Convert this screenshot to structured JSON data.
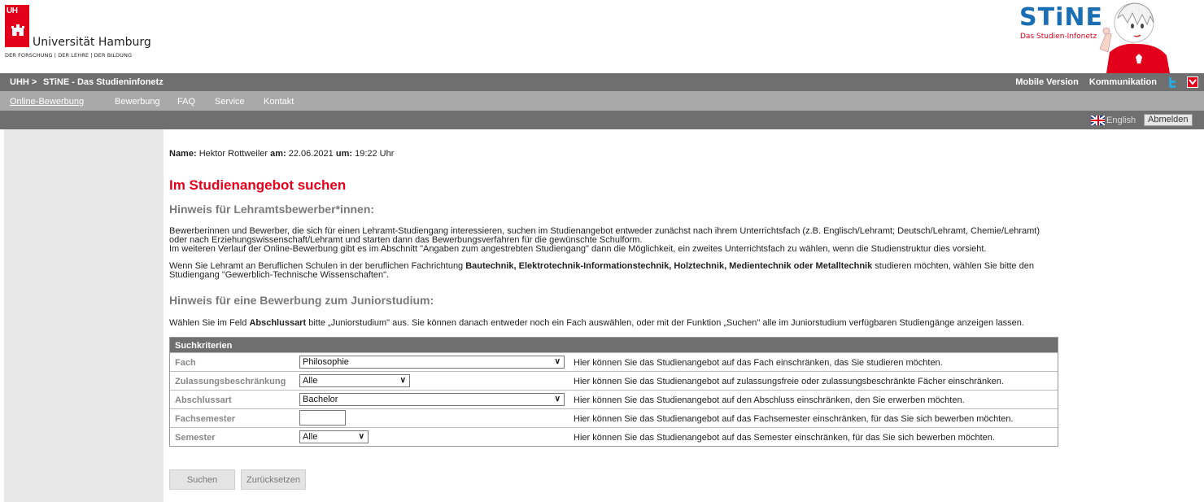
{
  "header": {
    "uh_logo": "UH",
    "university_name": "Universität Hamburg",
    "motto": "DER FORSCHUNG | DER LEHRE | DER BILDUNG",
    "stine_logo": "STiNE",
    "stine_subtitle": "Das Studien-Infonetz"
  },
  "topbar": {
    "crumb_uhh": "UHH >",
    "crumb_stine": "STiNE - Das Studieninfonetz",
    "mobile_version": "Mobile Version",
    "communication": "Kommunikation"
  },
  "nav": [
    {
      "label": "Online-Bewerbung",
      "active": true
    },
    {
      "label": "Bewerbung",
      "active": false
    },
    {
      "label": "FAQ",
      "active": false
    },
    {
      "label": "Service",
      "active": false
    },
    {
      "label": "Kontakt",
      "active": false
    }
  ],
  "langbar": {
    "english": "English",
    "logout": "Abmelden"
  },
  "user": {
    "name_label": "Name:",
    "name": "Hektor Rottweiler",
    "date_label": "am:",
    "date": "22.06.2021",
    "time_label": "um:",
    "time": "19:22 Uhr"
  },
  "content": {
    "title": "Im Studienangebot suchen",
    "hint1_title": "Hinweis für Lehramtsbewerber*innen:",
    "hint1_p1_line1": "Bewerberinnen und Bewerber, die sich für einen Lehramt-Studiengang interessieren, suchen im Studienangebot entweder zunächst nach ihrem Unterrichtsfach (z.B. Englisch/Lehramt; Deutsch/Lehramt, Chemie/Lehramt)",
    "hint1_p1_line2": "oder nach Erziehungswissenschaft/Lehramt und starten dann das Bewerbungsverfahren für die gewünschte Schulform.",
    "hint1_p1_line3": "Im weiteren Verlauf der Online-Bewerbung gibt es im Abschnitt \"Angaben zum angestrebten Studiengang\" dann die Möglichkeit, ein zweites Unterrichtsfach zu wählen, wenn die Studienstruktur dies vorsieht.",
    "hint1_p2_pre": "Wenn Sie Lehramt an Beruflichen Schulen in der beruflichen Fachrichtung ",
    "hint1_p2_bold": "Bautechnik, Elektrotechnik-Informationstechnik, Holztechnik, Medientechnik oder Metalltechnik",
    "hint1_p2_post": " studieren möchten, wählen Sie bitte den",
    "hint1_p2_line2": "Studiengang \"Gewerblich-Technische Wissenschaften\".",
    "hint2_title": "Hinweis für eine Bewerbung zum Juniorstudium:",
    "hint2_pre": "Wählen Sie im Feld ",
    "hint2_bold": "Abschlussart",
    "hint2_post": " bitte „Juniorstudium\" aus. Sie können danach entweder noch ein Fach auswählen, oder mit der Funktion „Suchen\" alle im Juniorstudium verfügbaren Studiengänge anzeigen lassen."
  },
  "criteria": {
    "header": "Suchkriterien",
    "rows": [
      {
        "label": "Fach",
        "value": "Philosophie",
        "hint": "Hier können Sie das Studienangebot auf das Fach einschränken, das Sie studieren möchten."
      },
      {
        "label": "Zulassungsbeschränkung",
        "value": "Alle",
        "hint": "Hier können Sie das Studienangebot auf zulassungsfreie oder zulassungsbeschränkte Fächer einschränken."
      },
      {
        "label": "Abschlussart",
        "value": "Bachelor",
        "hint": "Hier können Sie das Studienangebot auf den Abschluss einschränken, den Sie erwerben möchten."
      },
      {
        "label": "Fachsemester",
        "value": "",
        "hint": "Hier können Sie das Studienangebot auf das Fachsemester einschränken, für das Sie sich bewerben möchten."
      },
      {
        "label": "Semester",
        "value": "Alle",
        "hint": "Hier können Sie das Studienangebot auf das Semester einschränken, für das Sie sich bewerben möchten."
      }
    ]
  },
  "buttons": {
    "search": "Suchen",
    "reset": "Zurücksetzen"
  },
  "colors": {
    "brand_red": "#e2001a",
    "bar_dark": "#6f6f6f",
    "bar_light": "#a9a9a9",
    "stine_blue": "#1a6fb4"
  }
}
